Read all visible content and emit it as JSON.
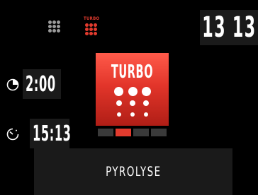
{
  "header": {
    "mode_label": "TURBO"
  },
  "clock": {
    "time": "13 13"
  },
  "cook_time": {
    "value": "2:00"
  },
  "end_time": {
    "value": "15:13"
  },
  "program": {
    "title": "TURBO",
    "page_count": 4,
    "active_page": 2
  },
  "bottom": {
    "label": "PYROLYSE"
  },
  "colors": {
    "accent": "#e23b2e",
    "panel": "#1a1a1a",
    "background": "#000000"
  }
}
